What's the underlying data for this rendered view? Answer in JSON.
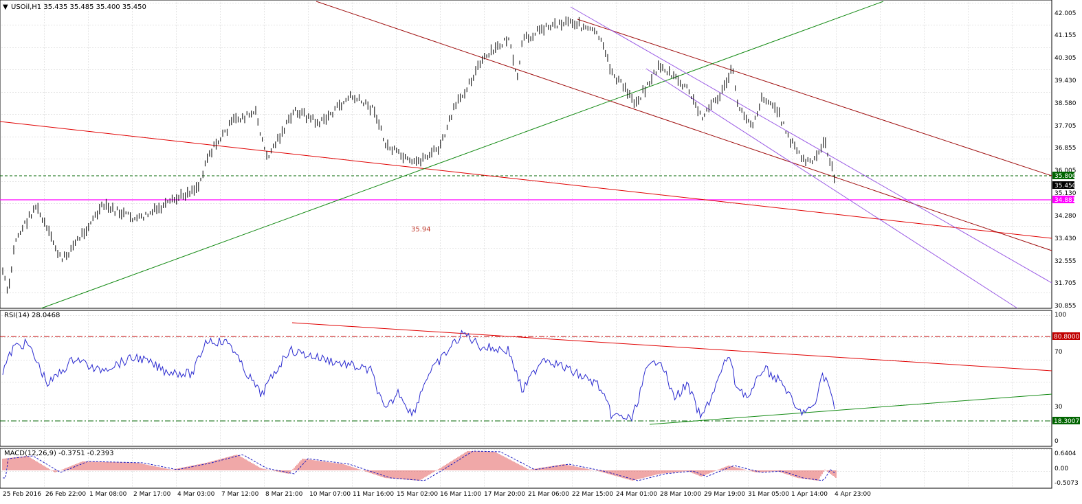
{
  "symbol_header": "USOil,H1  35.435 35.485 35.400 35.450",
  "chart_label": "35.94",
  "price_axis": {
    "ticks": [
      "42.005",
      "41.155",
      "40.305",
      "39.430",
      "38.580",
      "37.705",
      "36.855",
      "36.005",
      "35.130",
      "34.280",
      "33.430",
      "32.555",
      "31.705",
      "30.855"
    ],
    "markers": [
      {
        "label": "35.800",
        "color": "#006400"
      },
      {
        "label": "35.450",
        "color": "#000000"
      },
      {
        "label": "34.881",
        "color": "#ff00ff"
      }
    ]
  },
  "rsi_panel": {
    "header": "RSI(14) 28.0468",
    "ticks": [
      "100",
      "70",
      "30",
      "0"
    ],
    "markers": [
      {
        "label": "80.8000",
        "color": "#c00000"
      },
      {
        "label": "18.3007",
        "color": "#006400"
      }
    ]
  },
  "macd_panel": {
    "header": "MACD(12,26,9) -0.3751 -0.2393",
    "ticks": [
      "0.6404",
      "0.00",
      "-0.5073"
    ]
  },
  "time_axis": [
    "25 Feb 2016",
    "26 Feb 22:00",
    "1 Mar 08:00",
    "2 Mar 17:00",
    "4 Mar 03:00",
    "7 Mar 12:00",
    "8 Mar 21:00",
    "10 Mar 07:00",
    "11 Mar 16:00",
    "15 Mar 02:00",
    "16 Mar 11:00",
    "17 Mar 20:00",
    "21 Mar 06:00",
    "22 Mar 15:00",
    "24 Mar 01:00",
    "28 Mar 10:00",
    "29 Mar 19:00",
    "31 Mar 05:00",
    "1 Apr 14:00",
    "4 Apr 23:00"
  ],
  "colors": {
    "grid": "#c8c8c8",
    "candles": "#000000",
    "trend_red": "#e00000",
    "trend_darkred": "#a01010",
    "trend_green": "#138a13",
    "trend_purple": "#9b5de5",
    "rsi_line": "#2b2bd0",
    "macd_hist": "#e05050",
    "macd_signal": "#1c1cc0"
  }
}
